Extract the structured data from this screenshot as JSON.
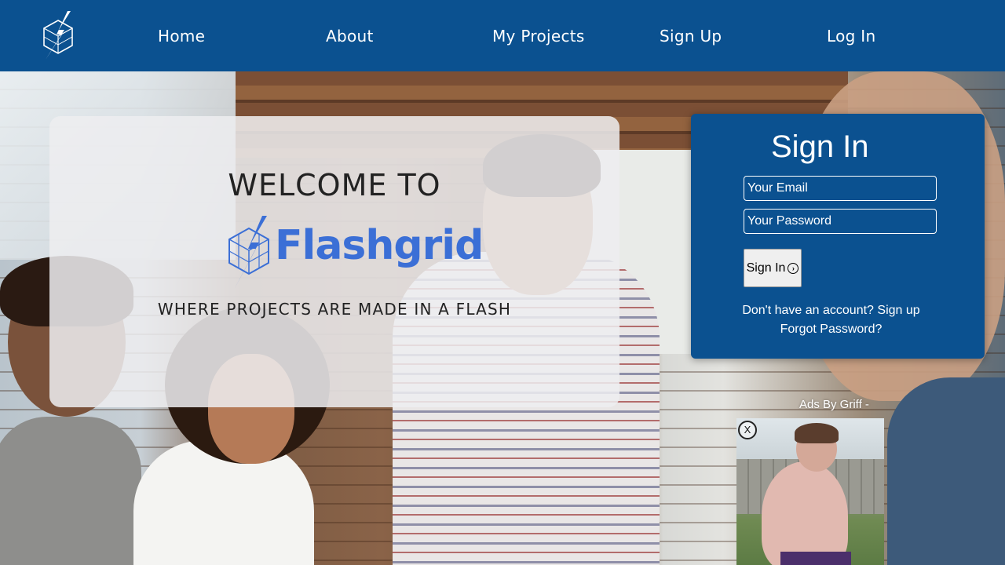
{
  "nav": {
    "logo_icon": "lightning-cube-icon",
    "links": [
      "Home",
      "About",
      "My Projects",
      "Sign Up",
      "Log In"
    ]
  },
  "welcome": {
    "heading": "WELCOME TO",
    "brand": "Flashgrid",
    "tagline": "WHERE PROJECTS ARE MADE IN A FLASH"
  },
  "signin": {
    "title": "Sign In",
    "email_placeholder": "Your Email",
    "password_placeholder": "Your Password",
    "button_label": "Sign In",
    "button_icon": "arrow-right-circle-icon",
    "signup_prompt": "Don't have an account?",
    "signup_link": "Sign up",
    "forgot_link": "Forgot Password?"
  },
  "ad": {
    "label": "Ads By Griff -",
    "close_label": "X"
  },
  "colors": {
    "brand_blue": "#0b5190",
    "flashgrid_blue": "#3b6fd6"
  }
}
